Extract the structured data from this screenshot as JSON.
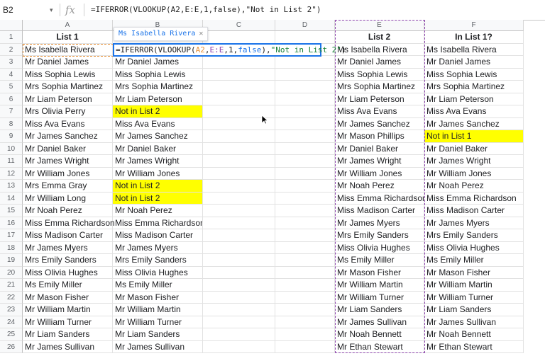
{
  "formula_bar": {
    "name_box": "B2",
    "fx_label": "fx",
    "formula": "=IFERROR(VLOOKUP(A2,E:E,1,false),\"Not in List 2\")"
  },
  "chip_label": "Ms Isabella Rivera",
  "editor": {
    "p1": "=IFERROR(VLOOKUP(",
    "ref_a2": "A2",
    "p2": ",",
    "ref_ee": "E:E",
    "p3": ",1,",
    "kw": "false",
    "p4": "),",
    "str": "\"Not in List 2\"",
    "p5": ")"
  },
  "columns": [
    "A",
    "B",
    "C",
    "D",
    "E",
    "F"
  ],
  "rows": [
    {
      "n": "1",
      "a": "List 1",
      "b": "",
      "e": "List 2",
      "f": "In List 1?"
    },
    {
      "n": "2",
      "a": "Ms Isabella Rivera",
      "b": "",
      "e": "Ms Isabella Rivera",
      "f": "Ms Isabella Rivera"
    },
    {
      "n": "3",
      "a": "Mr Daniel James",
      "b": "Mr Daniel James",
      "e": "Mr Daniel James",
      "f": "Mr Daniel James"
    },
    {
      "n": "4",
      "a": "Miss Sophia Lewis",
      "b": "Miss Sophia Lewis",
      "e": "Miss Sophia Lewis",
      "f": "Miss Sophia Lewis"
    },
    {
      "n": "5",
      "a": "Mrs Sophia Martinez",
      "b": "Mrs Sophia Martinez",
      "e": "Mrs Sophia Martinez",
      "f": "Mrs Sophia Martinez"
    },
    {
      "n": "6",
      "a": "Mr Liam Peterson",
      "b": "Mr Liam Peterson",
      "e": "Mr Liam Peterson",
      "f": "Mr Liam Peterson"
    },
    {
      "n": "7",
      "a": "Mrs Olivia Perry",
      "b": "Not in List 2",
      "e": "Miss Ava Evans",
      "f": "Miss Ava Evans"
    },
    {
      "n": "8",
      "a": "Miss Ava Evans",
      "b": "Miss Ava Evans",
      "e": "Mr James Sanchez",
      "f": "Mr James Sanchez"
    },
    {
      "n": "9",
      "a": "Mr James Sanchez",
      "b": "Mr James Sanchez",
      "e": "Mr Mason Phillips",
      "f": "Not in List 1"
    },
    {
      "n": "10",
      "a": "Mr Daniel Baker",
      "b": "Mr Daniel Baker",
      "e": "Mr Daniel Baker",
      "f": "Mr Daniel Baker"
    },
    {
      "n": "11",
      "a": "Mr James Wright",
      "b": "Mr James Wright",
      "e": "Mr James Wright",
      "f": "Mr James Wright"
    },
    {
      "n": "12",
      "a": "Mr William Jones",
      "b": "Mr William Jones",
      "e": "Mr William Jones",
      "f": "Mr William Jones"
    },
    {
      "n": "13",
      "a": "Mrs Emma Gray",
      "b": "Not in List 2",
      "e": "Mr Noah Perez",
      "f": "Mr Noah Perez"
    },
    {
      "n": "14",
      "a": "Mr William Long",
      "b": "Not in List 2",
      "e": "Miss Emma Richardson",
      "f": "Miss Emma Richardson"
    },
    {
      "n": "15",
      "a": "Mr Noah Perez",
      "b": "Mr Noah Perez",
      "e": "Miss Madison Carter",
      "f": "Miss Madison Carter"
    },
    {
      "n": "16",
      "a": "Miss Emma Richardson",
      "b": "Miss Emma Richardson",
      "e": "Mr James Myers",
      "f": "Mr James Myers"
    },
    {
      "n": "17",
      "a": "Miss Madison Carter",
      "b": "Miss Madison Carter",
      "e": "Mrs Emily Sanders",
      "f": "Mrs Emily Sanders"
    },
    {
      "n": "18",
      "a": "Mr James Myers",
      "b": "Mr James Myers",
      "e": "Miss Olivia Hughes",
      "f": "Miss Olivia Hughes"
    },
    {
      "n": "19",
      "a": "Mrs Emily Sanders",
      "b": "Mrs Emily Sanders",
      "e": "Ms Emily Miller",
      "f": "Ms Emily Miller"
    },
    {
      "n": "20",
      "a": "Miss Olivia Hughes",
      "b": "Miss Olivia Hughes",
      "e": "Mr Mason Fisher",
      "f": "Mr Mason Fisher"
    },
    {
      "n": "21",
      "a": "Ms Emily Miller",
      "b": "Ms Emily Miller",
      "e": "Mr William Martin",
      "f": "Mr William Martin"
    },
    {
      "n": "22",
      "a": "Mr Mason Fisher",
      "b": "Mr Mason Fisher",
      "e": "Mr William Turner",
      "f": "Mr William Turner"
    },
    {
      "n": "23",
      "a": "Mr William Martin",
      "b": "Mr William Martin",
      "e": "Mr Liam Sanders",
      "f": "Mr Liam Sanders"
    },
    {
      "n": "24",
      "a": "Mr William Turner",
      "b": "Mr William Turner",
      "e": "Mr James Sullivan",
      "f": "Mr James Sullivan"
    },
    {
      "n": "25",
      "a": "Mr Liam Sanders",
      "b": "Mr Liam Sanders",
      "e": "Mr Noah Bennett",
      "f": "Mr Noah Bennett"
    },
    {
      "n": "26",
      "a": "Mr James Sullivan",
      "b": "Mr James Sullivan",
      "e": "Mr Ethan Stewart",
      "f": "Mr Ethan Stewart"
    }
  ],
  "highlights": {
    "color": "#ffff00"
  },
  "accent": {
    "selection": "#1a73e8",
    "ref_a2": "#e69138",
    "ref_ee": "#8e44ad"
  }
}
